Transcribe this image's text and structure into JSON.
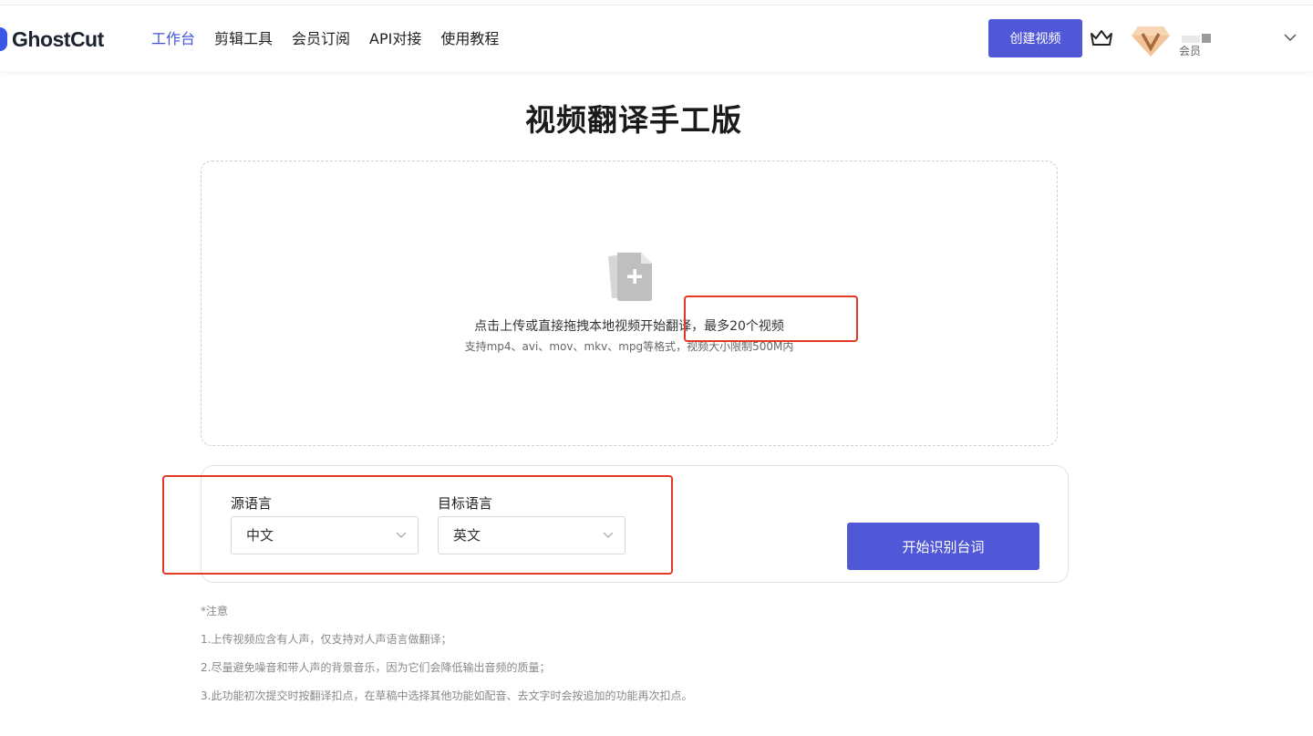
{
  "header": {
    "brand": "GhostCut",
    "nav": [
      {
        "label": "工作台",
        "active": true
      },
      {
        "label": "剪辑工具",
        "active": false
      },
      {
        "label": "会员订阅",
        "active": false
      },
      {
        "label": "API对接",
        "active": false
      },
      {
        "label": "使用教程",
        "active": false
      }
    ],
    "create_button": "创建视频",
    "member_label": "会员",
    "icons": {
      "crown": "crown-icon",
      "vip": "vip-diamond-icon",
      "dropdown": "chevron-down-icon"
    }
  },
  "main": {
    "title": "视频翻译手工版",
    "upload": {
      "instruction": "点击上传或直接拖拽本地视频开始翻译，最多20个视频",
      "formats": "支持mp4、avi、mov、mkv、mpg等格式，视频大小限制500M内",
      "icon": "file-add-icon"
    },
    "languages": {
      "source_label": "源语言",
      "source_value": "中文",
      "target_label": "目标语言",
      "target_value": "英文"
    },
    "start_button": "开始识别台词",
    "notes": {
      "heading": "*注意",
      "items": [
        "1.上传视频应含有人声，仅支持对人声语言做翻译；",
        "2.尽量避免噪音和带人声的背景音乐，因为它们会降低输出音频的质量；",
        "3.此功能初次提交时按翻译扣点，在草稿中选择其他功能如配音、去文字时会按追加的功能再次扣点。"
      ]
    }
  },
  "colors": {
    "accent": "#5058d8",
    "nav_active": "#4054d8",
    "annotation_red": "#e03a25"
  }
}
